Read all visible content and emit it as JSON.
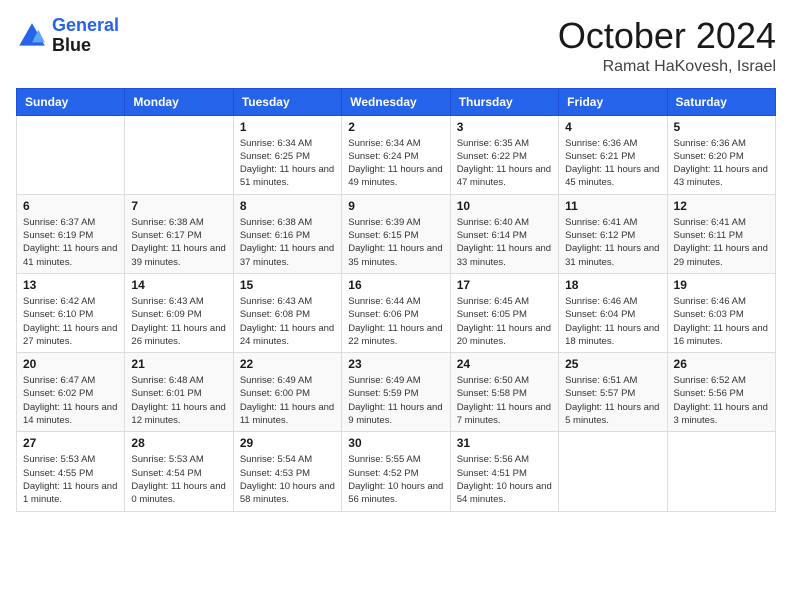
{
  "header": {
    "logo_line1": "General",
    "logo_line2": "Blue",
    "month": "October 2024",
    "location": "Ramat HaKovesh, Israel"
  },
  "days_of_week": [
    "Sunday",
    "Monday",
    "Tuesday",
    "Wednesday",
    "Thursday",
    "Friday",
    "Saturday"
  ],
  "weeks": [
    [
      {
        "day": "",
        "info": ""
      },
      {
        "day": "",
        "info": ""
      },
      {
        "day": "1",
        "info": "Sunrise: 6:34 AM\nSunset: 6:25 PM\nDaylight: 11 hours and 51 minutes."
      },
      {
        "day": "2",
        "info": "Sunrise: 6:34 AM\nSunset: 6:24 PM\nDaylight: 11 hours and 49 minutes."
      },
      {
        "day": "3",
        "info": "Sunrise: 6:35 AM\nSunset: 6:22 PM\nDaylight: 11 hours and 47 minutes."
      },
      {
        "day": "4",
        "info": "Sunrise: 6:36 AM\nSunset: 6:21 PM\nDaylight: 11 hours and 45 minutes."
      },
      {
        "day": "5",
        "info": "Sunrise: 6:36 AM\nSunset: 6:20 PM\nDaylight: 11 hours and 43 minutes."
      }
    ],
    [
      {
        "day": "6",
        "info": "Sunrise: 6:37 AM\nSunset: 6:19 PM\nDaylight: 11 hours and 41 minutes."
      },
      {
        "day": "7",
        "info": "Sunrise: 6:38 AM\nSunset: 6:17 PM\nDaylight: 11 hours and 39 minutes."
      },
      {
        "day": "8",
        "info": "Sunrise: 6:38 AM\nSunset: 6:16 PM\nDaylight: 11 hours and 37 minutes."
      },
      {
        "day": "9",
        "info": "Sunrise: 6:39 AM\nSunset: 6:15 PM\nDaylight: 11 hours and 35 minutes."
      },
      {
        "day": "10",
        "info": "Sunrise: 6:40 AM\nSunset: 6:14 PM\nDaylight: 11 hours and 33 minutes."
      },
      {
        "day": "11",
        "info": "Sunrise: 6:41 AM\nSunset: 6:12 PM\nDaylight: 11 hours and 31 minutes."
      },
      {
        "day": "12",
        "info": "Sunrise: 6:41 AM\nSunset: 6:11 PM\nDaylight: 11 hours and 29 minutes."
      }
    ],
    [
      {
        "day": "13",
        "info": "Sunrise: 6:42 AM\nSunset: 6:10 PM\nDaylight: 11 hours and 27 minutes."
      },
      {
        "day": "14",
        "info": "Sunrise: 6:43 AM\nSunset: 6:09 PM\nDaylight: 11 hours and 26 minutes."
      },
      {
        "day": "15",
        "info": "Sunrise: 6:43 AM\nSunset: 6:08 PM\nDaylight: 11 hours and 24 minutes."
      },
      {
        "day": "16",
        "info": "Sunrise: 6:44 AM\nSunset: 6:06 PM\nDaylight: 11 hours and 22 minutes."
      },
      {
        "day": "17",
        "info": "Sunrise: 6:45 AM\nSunset: 6:05 PM\nDaylight: 11 hours and 20 minutes."
      },
      {
        "day": "18",
        "info": "Sunrise: 6:46 AM\nSunset: 6:04 PM\nDaylight: 11 hours and 18 minutes."
      },
      {
        "day": "19",
        "info": "Sunrise: 6:46 AM\nSunset: 6:03 PM\nDaylight: 11 hours and 16 minutes."
      }
    ],
    [
      {
        "day": "20",
        "info": "Sunrise: 6:47 AM\nSunset: 6:02 PM\nDaylight: 11 hours and 14 minutes."
      },
      {
        "day": "21",
        "info": "Sunrise: 6:48 AM\nSunset: 6:01 PM\nDaylight: 11 hours and 12 minutes."
      },
      {
        "day": "22",
        "info": "Sunrise: 6:49 AM\nSunset: 6:00 PM\nDaylight: 11 hours and 11 minutes."
      },
      {
        "day": "23",
        "info": "Sunrise: 6:49 AM\nSunset: 5:59 PM\nDaylight: 11 hours and 9 minutes."
      },
      {
        "day": "24",
        "info": "Sunrise: 6:50 AM\nSunset: 5:58 PM\nDaylight: 11 hours and 7 minutes."
      },
      {
        "day": "25",
        "info": "Sunrise: 6:51 AM\nSunset: 5:57 PM\nDaylight: 11 hours and 5 minutes."
      },
      {
        "day": "26",
        "info": "Sunrise: 6:52 AM\nSunset: 5:56 PM\nDaylight: 11 hours and 3 minutes."
      }
    ],
    [
      {
        "day": "27",
        "info": "Sunrise: 5:53 AM\nSunset: 4:55 PM\nDaylight: 11 hours and 1 minute."
      },
      {
        "day": "28",
        "info": "Sunrise: 5:53 AM\nSunset: 4:54 PM\nDaylight: 11 hours and 0 minutes."
      },
      {
        "day": "29",
        "info": "Sunrise: 5:54 AM\nSunset: 4:53 PM\nDaylight: 10 hours and 58 minutes."
      },
      {
        "day": "30",
        "info": "Sunrise: 5:55 AM\nSunset: 4:52 PM\nDaylight: 10 hours and 56 minutes."
      },
      {
        "day": "31",
        "info": "Sunrise: 5:56 AM\nSunset: 4:51 PM\nDaylight: 10 hours and 54 minutes."
      },
      {
        "day": "",
        "info": ""
      },
      {
        "day": "",
        "info": ""
      }
    ]
  ]
}
